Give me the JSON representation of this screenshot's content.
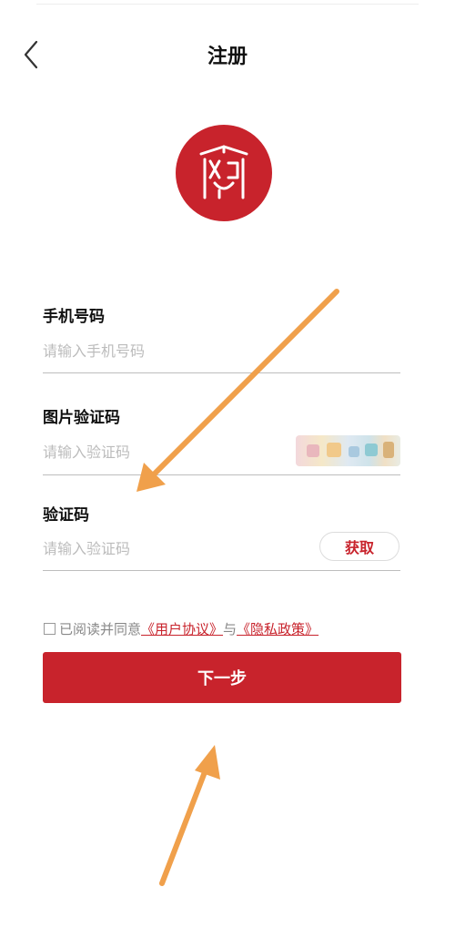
{
  "header": {
    "title": "注册"
  },
  "logo": {
    "icon": "seal-logo-icon",
    "color": "#c8232c"
  },
  "form": {
    "phone": {
      "label": "手机号码",
      "placeholder": "请输入手机号码"
    },
    "image_code": {
      "label": "图片验证码",
      "placeholder": "请输入验证码"
    },
    "sms_code": {
      "label": "验证码",
      "placeholder": "请输入验证码",
      "get_label": "获取"
    }
  },
  "agreement": {
    "prefix": "已阅读并同意",
    "user_agreement": "《用户协议》",
    "conj": "与",
    "privacy_policy": "《隐私政策》"
  },
  "next_button": {
    "label": "下一步"
  },
  "colors": {
    "brand": "#c8232c",
    "annotation_arrow": "#f0a04b"
  }
}
